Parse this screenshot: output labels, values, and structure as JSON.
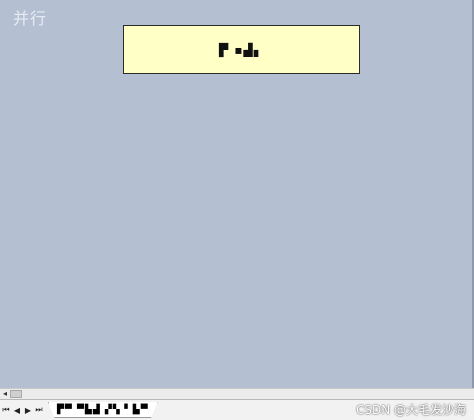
{
  "watermark_top": "并行",
  "element": {
    "label": "▛ ▪▟▖"
  },
  "nav": {
    "first": "⏮",
    "prev": "◀",
    "next": "▶",
    "last": "⏭"
  },
  "tabs": [
    {
      "label": "▛▀ ▀▙▟ ▞▚▝ ▙▀"
    }
  ],
  "watermark_bottom": "CSDN @大毛发沙海",
  "colors": {
    "canvas": "#b4c0d2",
    "element_fill": "#ffffc6"
  }
}
